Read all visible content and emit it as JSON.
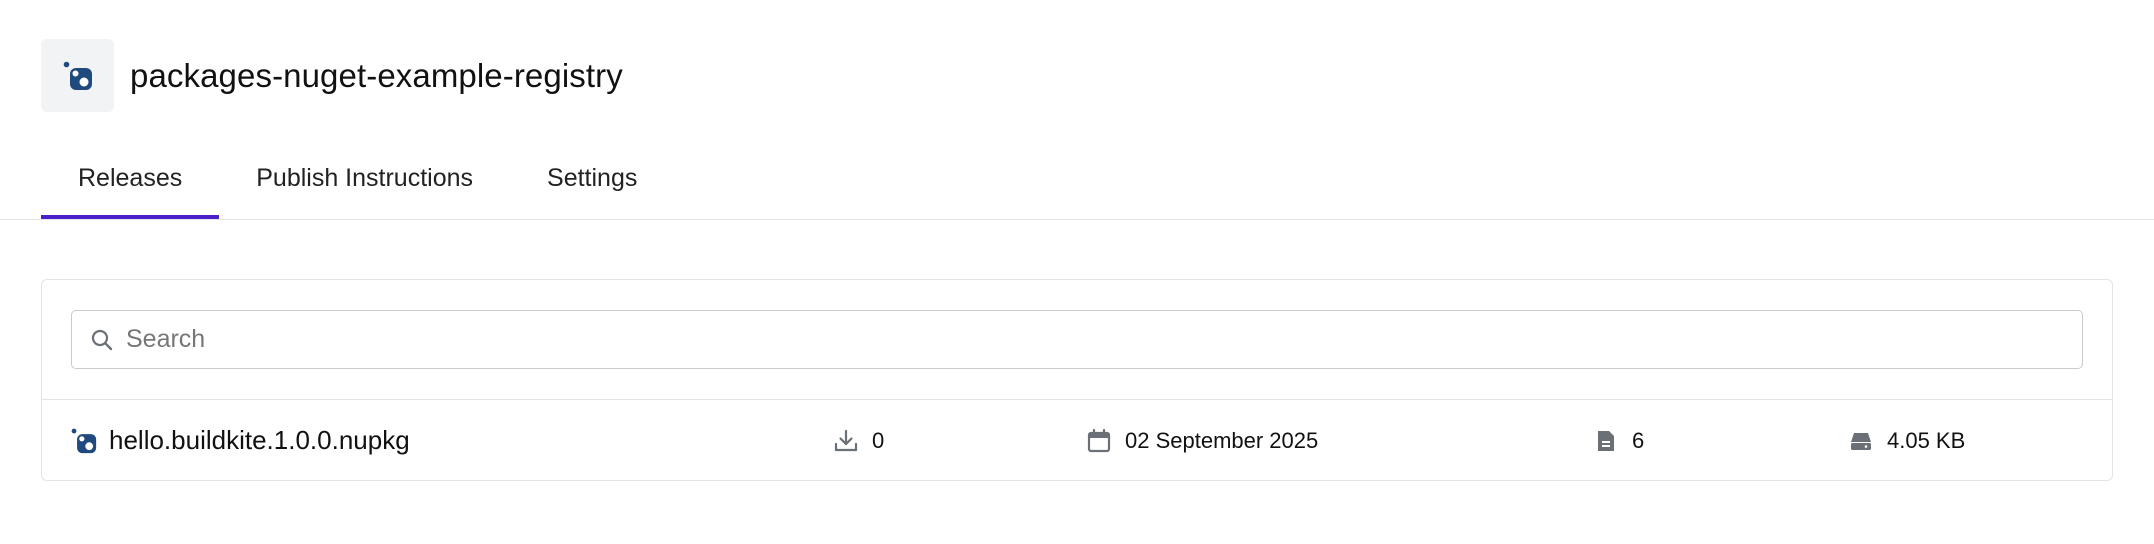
{
  "header": {
    "title": "packages-nuget-example-registry",
    "logo_icon": "nuget-logo-icon"
  },
  "tabs": [
    {
      "label": "Releases",
      "active": true
    },
    {
      "label": "Publish Instructions",
      "active": false
    },
    {
      "label": "Settings",
      "active": false
    }
  ],
  "search": {
    "placeholder": "Search",
    "value": ""
  },
  "packages": [
    {
      "name": "hello.buildkite.1.0.0.nupkg",
      "downloads": "0",
      "date": "02 September 2025",
      "files": "6",
      "size": "4.05 KB"
    }
  ],
  "colors": {
    "accent": "#4a21c9",
    "nuget_blue": "#1f4a7d",
    "icon_gray": "#6b6f76"
  }
}
